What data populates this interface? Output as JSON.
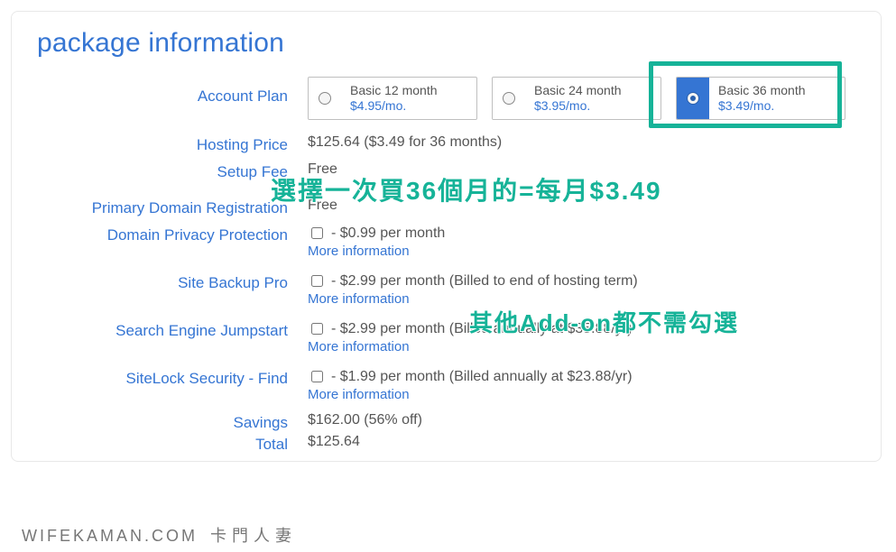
{
  "section_title": "package information",
  "labels": {
    "account_plan": "Account Plan",
    "hosting_price": "Hosting Price",
    "setup_fee": "Setup Fee",
    "primary_domain_reg": "Primary Domain Registration",
    "domain_privacy": "Domain Privacy Protection",
    "site_backup": "Site Backup Pro",
    "search_engine_jumpstart": "Search Engine Jumpstart",
    "sitelock": "SiteLock Security - Find",
    "savings": "Savings",
    "total": "Total"
  },
  "plans": [
    {
      "name": "Basic 12 month",
      "price": "$4.95/mo.",
      "selected": false
    },
    {
      "name": "Basic 24 month",
      "price": "$3.95/mo.",
      "selected": false
    },
    {
      "name": "Basic 36 month",
      "price": "$3.49/mo.",
      "selected": true
    }
  ],
  "hosting_price": "$125.64  ($3.49 for 36 months)",
  "setup_fee": "Free",
  "primary_domain_reg_value": "Free",
  "addons": {
    "domain_privacy": {
      "desc": "- $0.99 per month",
      "more": "More information"
    },
    "site_backup": {
      "desc": "- $2.99 per month (Billed to end of hosting term)",
      "more": "More information"
    },
    "search_engine_jumpstart": {
      "desc": "- $2.99 per month (Billed annually at $35.88/yr)",
      "more": "More information"
    },
    "sitelock": {
      "desc": "- $1.99 per month (Billed annually at $23.88/yr)",
      "more": "More information"
    }
  },
  "savings": "$162.00 (56% off)",
  "total": "$125.64",
  "annotations": {
    "line1": "選擇一次買36個月的=每月$3.49",
    "line2": "其他Add-on都不需勾選"
  },
  "watermark": {
    "en": "WIFEKAMAN.COM",
    "zh": "卡門人妻"
  }
}
